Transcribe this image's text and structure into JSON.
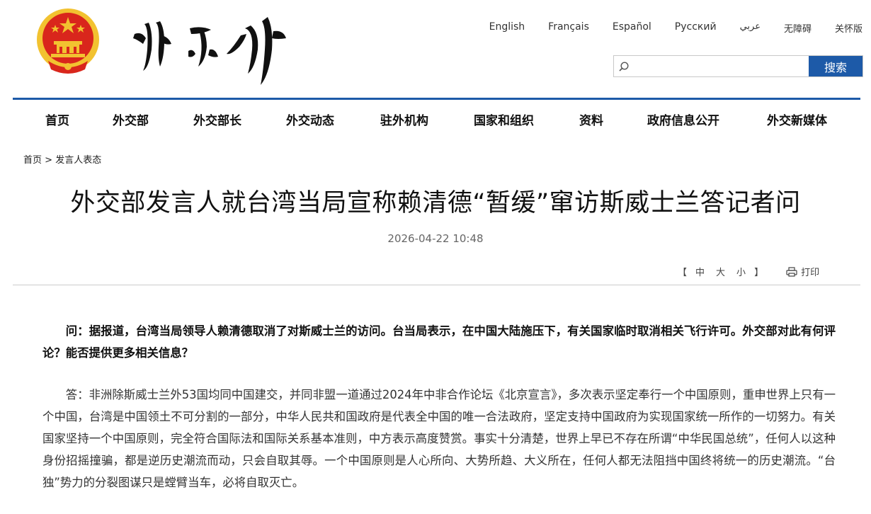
{
  "header": {
    "logo_text": "外交部",
    "languages": [
      "English",
      "Français",
      "Español",
      "Русский",
      "عربي",
      "无障碍",
      "关怀版"
    ],
    "search": {
      "placeholder": "",
      "button_label": "搜索"
    }
  },
  "nav": {
    "items": [
      "首页",
      "外交部",
      "外交部长",
      "外交动态",
      "驻外机构",
      "国家和组织",
      "资料",
      "政府信息公开",
      "外交新媒体"
    ]
  },
  "breadcrumb": {
    "home": "首页",
    "separator": ">",
    "current": "发言人表态"
  },
  "article": {
    "title": "外交部发言人就台湾当局宣称赖清德“暂缓”窜访斯威士兰答记者问",
    "date": "2026-04-22 10:48",
    "question": "问：据报道，台湾当局领导人赖清德取消了对斯威士兰的访问。台当局表示，在中国大陆施压下，有关国家临时取消相关飞行许可。外交部对此有何评论？能否提供更多相关信息？",
    "answer": "答：非洲除斯威士兰外53国均同中国建交，并同非盟一道通过2024年中非合作论坛《北京宣言》，多次表示坚定奉行一个中国原则，重申世界上只有一个中国，台湾是中国领土不可分割的一部分，中华人民共和国政府是代表全中国的唯一合法政府，坚定支持中国政府为实现国家统一所作的一切努力。有关国家坚持一个中国原则，完全符合国际法和国际关系基本准则，中方表示高度赞赏。事实十分清楚，世界上早已不存在所谓“中华民国总统”，任何人以这种身份招摇撞骗，都是逆历史潮流而动，只会自取其辱。一个中国原则是人心所向、大势所趋、大义所在，任何人都无法阻挡中国终将统一的历史潮流。“台独”势力的分裂图谋只是螳臂当车，必将自取灭亡。"
  },
  "tools": {
    "open_bracket": "【",
    "size_large": "中",
    "size_medium": "大",
    "size_small": "小",
    "close_bracket": "】",
    "print_label": "打印"
  },
  "colors": {
    "brand_blue": "#1d5aa8",
    "emblem_red": "#d9261c",
    "emblem_gold": "#f2c230"
  }
}
